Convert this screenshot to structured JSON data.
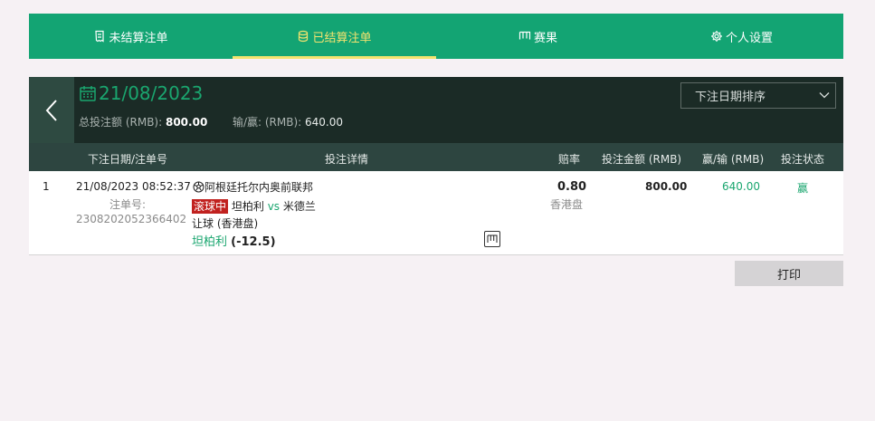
{
  "tabs": [
    {
      "label": "未结算注单",
      "icon": "receipt-icon",
      "active": false
    },
    {
      "label": "已结算注单",
      "icon": "coins-icon",
      "active": true
    },
    {
      "label": "赛果",
      "icon": "scoreboard-icon",
      "active": false
    },
    {
      "label": "个人设置",
      "icon": "gear-icon",
      "active": false
    }
  ],
  "header": {
    "date": "21/08/2023",
    "total_label": "总投注额 (RMB):",
    "total_value": "800.00",
    "winloss_label": "输/赢: (RMB):",
    "winloss_value": "640.00",
    "sort_label": "下注日期排序"
  },
  "columns": {
    "date_id": "下注日期/注单号",
    "details": "投注详情",
    "odds": "赔率",
    "stake": "投注金额 (RMB)",
    "winloss": "赢/输 (RMB)",
    "status": "投注状态"
  },
  "rows": [
    {
      "index": "1",
      "datetime": "21/08/2023 08:52:37",
      "id_label": "注单号:",
      "id_value": "2308202052366402",
      "league": "阿根廷托尔内奥前联邦",
      "live_badge": "滚球中",
      "home": "坦柏利",
      "vs": "vs",
      "away": "米德兰",
      "market": "让球 (香港盘)",
      "selection": "坦柏利",
      "handicap": "(-12.5)",
      "odds": "0.80",
      "odds_type": "香港盘",
      "stake": "800.00",
      "winloss": "640.00",
      "status": "赢"
    }
  ],
  "print_label": "打印",
  "colors": {
    "tab_bg": "#13a473",
    "tab_active": "#f3e36f",
    "header_bg": "#1b2b26",
    "accent_green": "#1aa66f",
    "live_red": "#c1211f"
  }
}
